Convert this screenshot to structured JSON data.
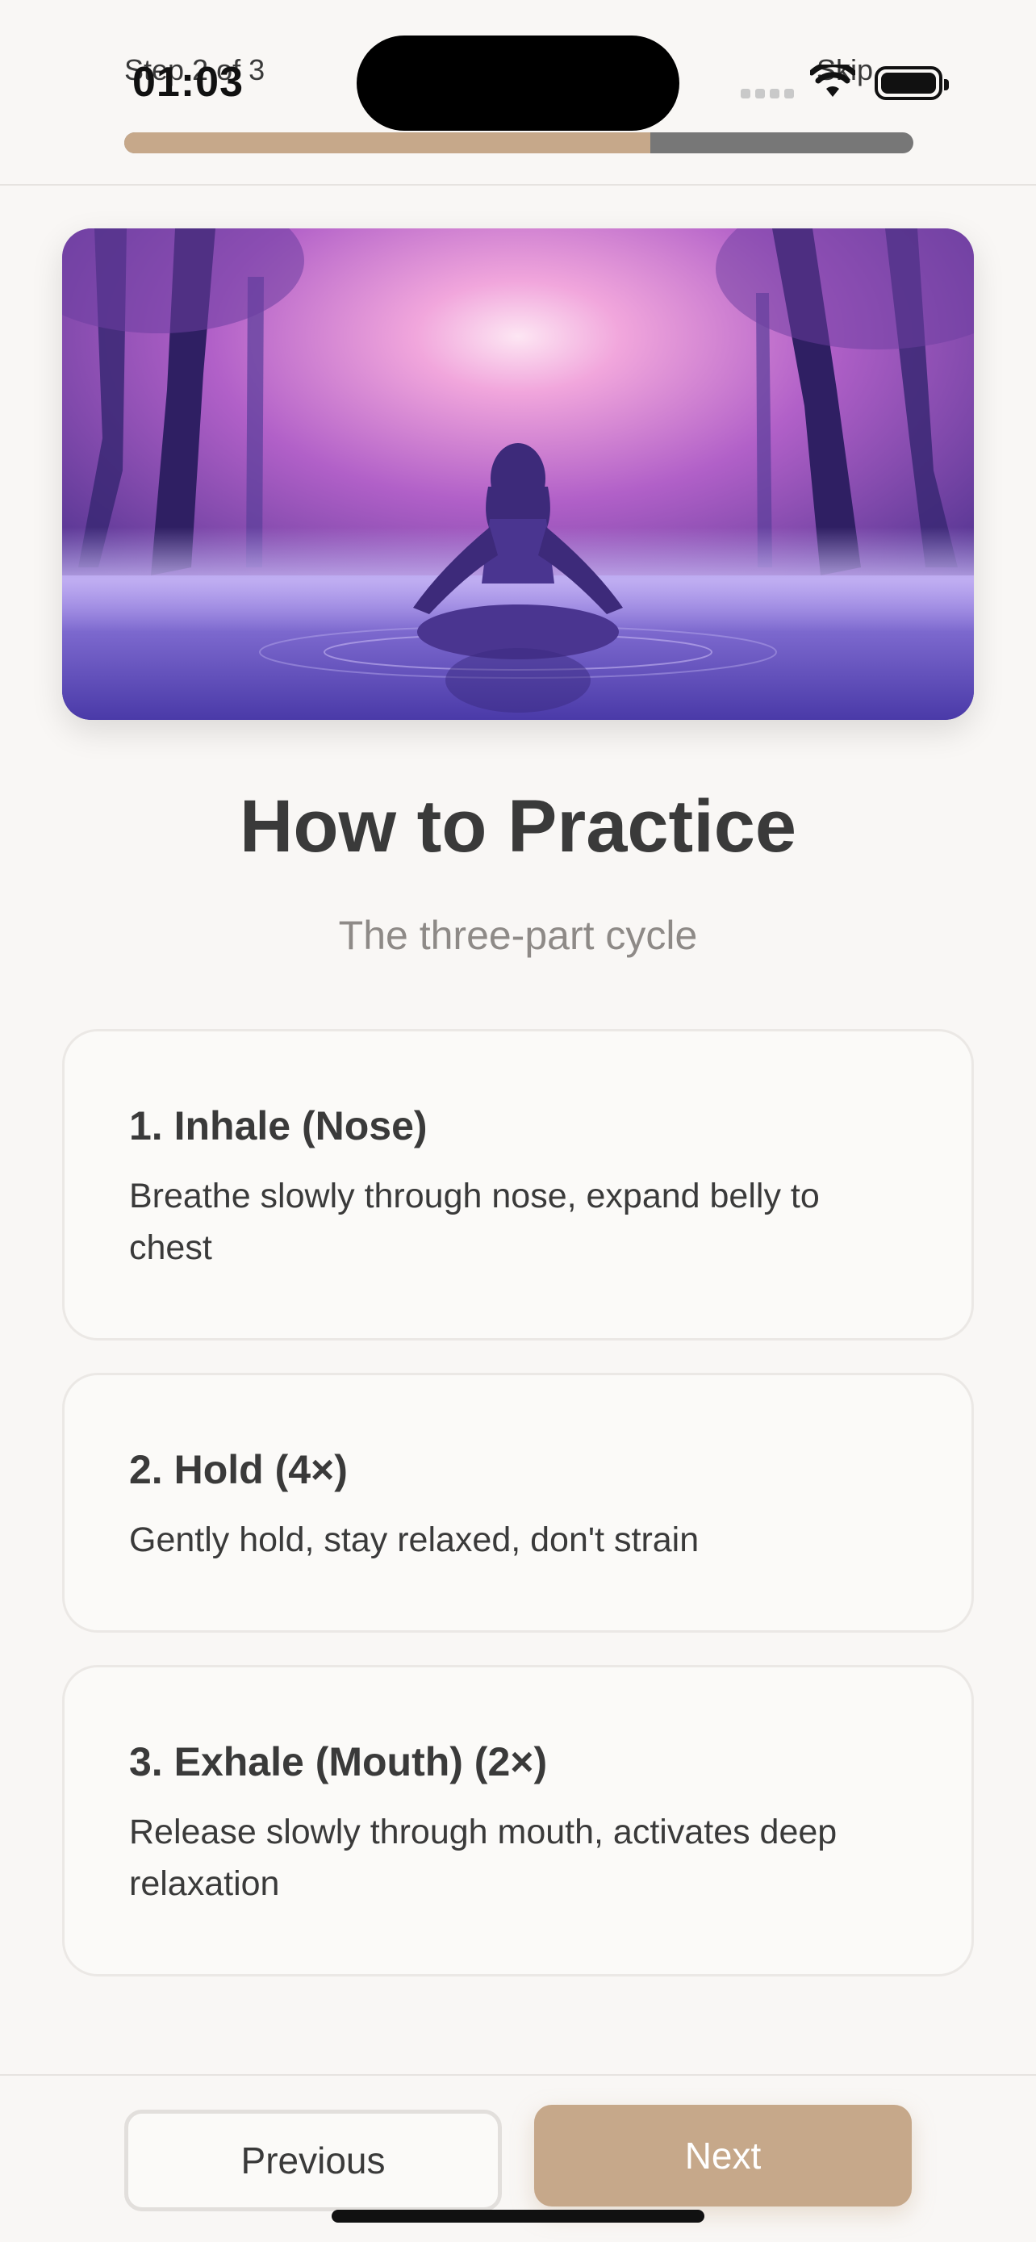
{
  "status_bar": {
    "time": "01:03"
  },
  "header": {
    "step_label": "Step 2 of 3",
    "skip_label": "Skip",
    "progress_fraction": 0.667
  },
  "hero": {
    "icon": "meditation-image"
  },
  "main": {
    "title": "How to Practice",
    "subtitle": "The three-part cycle",
    "steps": [
      {
        "title": "1. Inhale (Nose)",
        "text": "Breathe slowly through nose, expand belly to chest"
      },
      {
        "title": "2. Hold (4×)",
        "text": "Gently hold, stay relaxed, don't strain"
      },
      {
        "title": "3. Exhale (Mouth) (2×)",
        "text": "Release slowly through mouth, activates deep relaxation"
      }
    ]
  },
  "footer": {
    "previous_label": "Previous",
    "next_label": "Next"
  },
  "colors": {
    "accent": "#c6a88a",
    "background": "#f9f7f5",
    "text": "#3a3a3a",
    "muted": "#8e8a87"
  }
}
